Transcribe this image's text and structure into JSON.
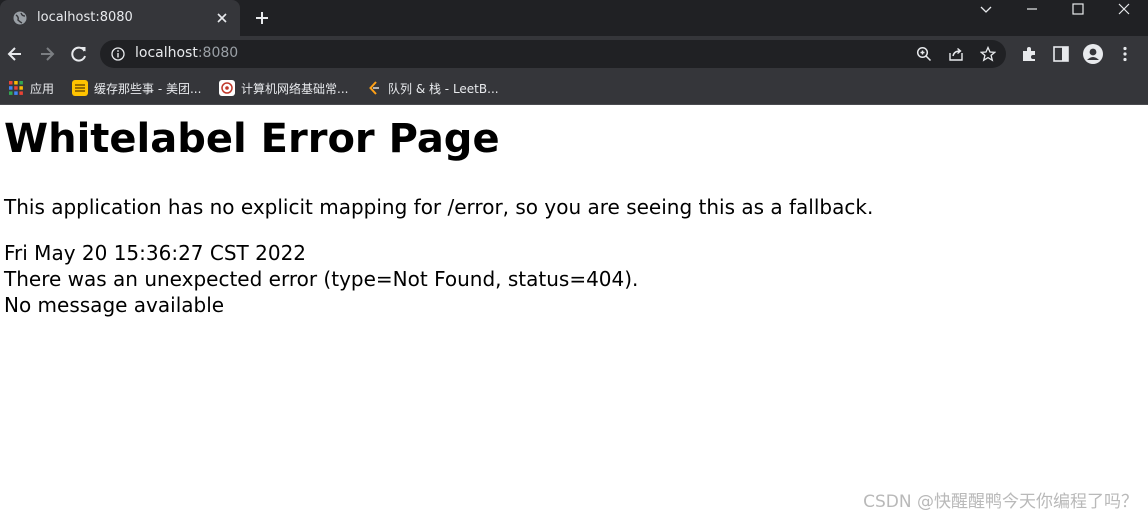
{
  "browser": {
    "tab": {
      "title": "localhost:8080"
    },
    "address": {
      "host": "localhost",
      "port": ":8080"
    },
    "bookmarks": [
      {
        "label": "应用",
        "icon": "apps-grid-icon",
        "color": "#ea4335"
      },
      {
        "label": "缓存那些事 - 美团...",
        "icon": "meituan-icon",
        "color": "#ffc300"
      },
      {
        "label": "计算机网络基础常...",
        "icon": "site-icon",
        "color": "#ffffff"
      },
      {
        "label": "队列 & 栈 - LeetB...",
        "icon": "leetcode-icon",
        "color": "#ffa116"
      }
    ]
  },
  "page": {
    "heading": "Whitelabel Error Page",
    "intro": "This application has no explicit mapping for /error, so you are seeing this as a fallback.",
    "timestamp": "Fri May 20 15:36:27 CST 2022",
    "error_line": "There was an unexpected error (type=Not Found, status=404).",
    "message": "No message available"
  },
  "watermark": "CSDN @快醒醒鸭今天你编程了吗？"
}
